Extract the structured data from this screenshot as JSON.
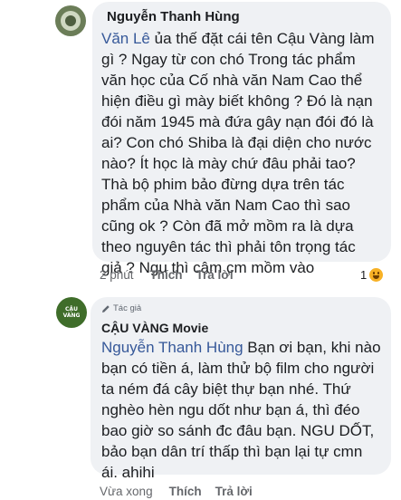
{
  "comments": [
    {
      "author": "Nguyễn Thanh Hùng",
      "mention": "Văn Lê",
      "first_line_rest": " ủa thế đặt cái tên Cậu Vàng làm",
      "lines": [
        "gì ? Ngay từ con chó Trong tác phẩm",
        "văn học của Cố nhà văn Nam Cao thể",
        "hiện điều gì mày biết không ? Đó là nạn",
        "đói năm 1945 mà đứa gây nạn đói đó là",
        "ai? Con chó Shiba là đại diện cho nước",
        "nào? Ít học là mày chứ đâu phải tao?",
        "Thà bộ phim bảo đừng dựa trên tác",
        "phẩm của Nhà văn Nam Cao thì sao",
        "cũng ok ? Còn đã mở mồm ra là dựa",
        "theo nguyên tác thì phải tôn trọng tác",
        "giả ? Ngu thì câm cm mồm vào"
      ],
      "time": "2 phút",
      "like_label": "Thích",
      "reply_label": "Trả lời",
      "reaction_count": "1",
      "reaction_icon": "haha-emoji-icon"
    },
    {
      "badge": "Tác giả",
      "author": "CẬU VÀNG Movie",
      "avatar_text": "CẬU VÀNG",
      "mention": "Nguyễn Thanh Hùng",
      "first_line_rest": " Bạn ơi bạn, khi nào",
      "lines": [
        "bạn có tiền á, làm thử bộ film cho người",
        "ta ném đá cây biệt thự bạn nhé. Thứ",
        "nghèo hèn ngu dốt như bạn á, thì đéo",
        "bao giờ so sánh đc đâu bạn. NGU DỐT,",
        "bảo bạn dân trí thấp thì bạn lại tự cmn",
        "ái. ahihi"
      ],
      "time": "Vừa xong",
      "like_label": "Thích",
      "reply_label": "Trả lời"
    }
  ],
  "colors": {
    "bubble": "#eff1f4",
    "mention": "#365899",
    "meta": "#65676b",
    "text": "#1c1e21"
  }
}
